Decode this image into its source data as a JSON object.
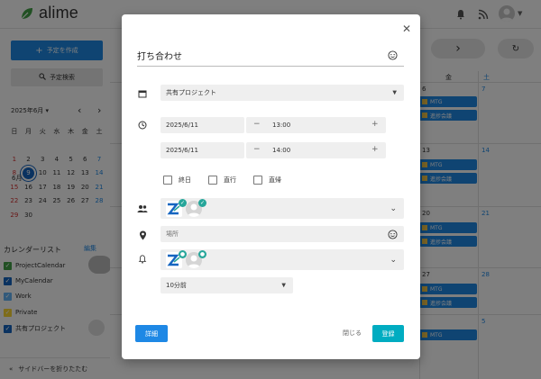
{
  "app": {
    "name": "alime"
  },
  "sidebar": {
    "create_label": "予定を作成",
    "search_label": "予定検索",
    "month_label": "2025年6月",
    "weekdays": [
      "日",
      "月",
      "火",
      "水",
      "木",
      "金",
      "土"
    ],
    "month_short": "6月",
    "weeks": [
      [
        "",
        "",
        "",
        "",
        "",
        "",
        ""
      ],
      [
        "1",
        "2",
        "3",
        "4",
        "5",
        "6",
        "7"
      ],
      [
        "8",
        "9",
        "10",
        "11",
        "12",
        "13",
        "14"
      ],
      [
        "15",
        "16",
        "17",
        "18",
        "19",
        "20",
        "21"
      ],
      [
        "22",
        "23",
        "24",
        "25",
        "26",
        "27",
        "28"
      ],
      [
        "29",
        "30",
        "",
        "",
        "",
        "",
        ""
      ]
    ],
    "cal_list_title": "カレンダーリスト",
    "cal_list_action": "編集",
    "calendars": [
      {
        "label": "ProjectCalendar",
        "color": "#43a047"
      },
      {
        "label": "MyCalendar",
        "color": "#1565c0"
      },
      {
        "label": "Work",
        "color": "#64b5f6"
      },
      {
        "label": "Private",
        "color": "#fdd835"
      },
      {
        "label": "共有プロジェクト",
        "color": "#1565c0"
      }
    ],
    "collapse_label": "サイドバーを折りたたむ"
  },
  "calendar": {
    "day_fri": "金",
    "day_sat": "土",
    "days": {
      "d6": "6",
      "d7": "7",
      "d13": "13",
      "d14": "14",
      "d20": "20",
      "d21": "21",
      "d27": "27",
      "d28": "28",
      "d5": "5"
    },
    "events": {
      "mtg": "MTG",
      "progress": "進捗会議"
    }
  },
  "modal": {
    "title": "打ち合わせ",
    "calendar_select": "共有プロジェクト",
    "start_date": "2025/6/11",
    "start_time": "13:00",
    "end_date": "2025/6/11",
    "end_time": "14:00",
    "checks": {
      "allday": "終日",
      "direct_go": "直行",
      "direct_return": "直帰"
    },
    "location_placeholder": "場所",
    "reminder": "10分前",
    "detail_label": "詳細",
    "close_label": "閉じる",
    "save_label": "登録",
    "minus": "−",
    "plus": "+"
  },
  "colors": {
    "accent": "#1e88e5",
    "save": "#00acc1",
    "event": "#1e88e5"
  }
}
